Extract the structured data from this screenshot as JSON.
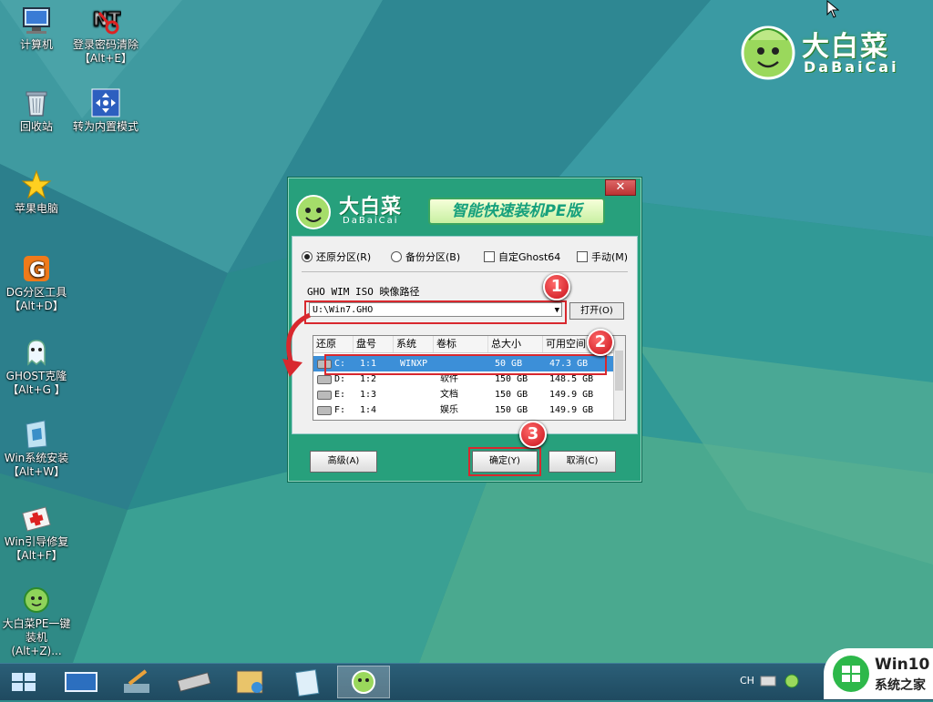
{
  "desktop": {
    "icons": [
      {
        "label": "计算机"
      },
      {
        "label": "登录密码清除\n【Alt+E】"
      },
      {
        "label": "回收站"
      },
      {
        "label": "转为内置模式"
      },
      {
        "label": "苹果电脑"
      },
      {
        "label": "DG分区工具\n【Alt+D】"
      },
      {
        "label": "GHOST克隆\n【Alt+G 】"
      },
      {
        "label": "Win系统安装\n【Alt+W】"
      },
      {
        "label": "Win引导修复\n【Alt+F】"
      },
      {
        "label": "大白菜PE一键\n装机(Alt+Z)..."
      }
    ],
    "brand": {
      "cn": "大白菜",
      "en": "DaBaiCai"
    }
  },
  "dialog": {
    "brand_cn": "大白菜",
    "brand_en": "DaBaiCai",
    "subtitle": "智能快速装机PE版",
    "close_label": "✕",
    "options": [
      {
        "label": "还原分区(R)",
        "type": "radio",
        "checked": true
      },
      {
        "label": "备份分区(B)",
        "type": "radio",
        "checked": false
      },
      {
        "label": "自定Ghost64",
        "type": "checkbox",
        "checked": false
      },
      {
        "label": "手动(M)",
        "type": "checkbox",
        "checked": false
      }
    ],
    "path_label": "GHO WIM ISO 映像路径",
    "path_value": "U:\\Win7.GHO",
    "open_button": "打开(O)",
    "table": {
      "headers": [
        "还原",
        "盘号",
        "系统",
        "卷标",
        "总大小",
        "可用空间"
      ],
      "rows": [
        {
          "drive": "C:",
          "disk": "1:1",
          "system": "WINXP",
          "label": "",
          "total": "50 GB",
          "free": "47.3 GB",
          "selected": true
        },
        {
          "drive": "D:",
          "disk": "1:2",
          "system": "",
          "label": "软件",
          "total": "150 GB",
          "free": "148.5 GB",
          "selected": false
        },
        {
          "drive": "E:",
          "disk": "1:3",
          "system": "",
          "label": "文档",
          "total": "150 GB",
          "free": "149.9 GB",
          "selected": false
        },
        {
          "drive": "F:",
          "disk": "1:4",
          "system": "",
          "label": "娱乐",
          "total": "150 GB",
          "free": "149.9 GB",
          "selected": false
        }
      ]
    },
    "buttons": {
      "advanced": "高级(A)",
      "ok": "确定(Y)",
      "cancel": "取消(C)"
    },
    "annotations": [
      "1",
      "2",
      "3"
    ]
  },
  "taskbar": {
    "tray_lang": "CH",
    "watermark_title": "Win10",
    "watermark_sub": "系统之家"
  },
  "colors": {
    "dialog_bg": "#27a07c",
    "selected_row": "#3c8fd8",
    "annotation_red": "#d8282e",
    "brand_green": "#2db84a"
  }
}
